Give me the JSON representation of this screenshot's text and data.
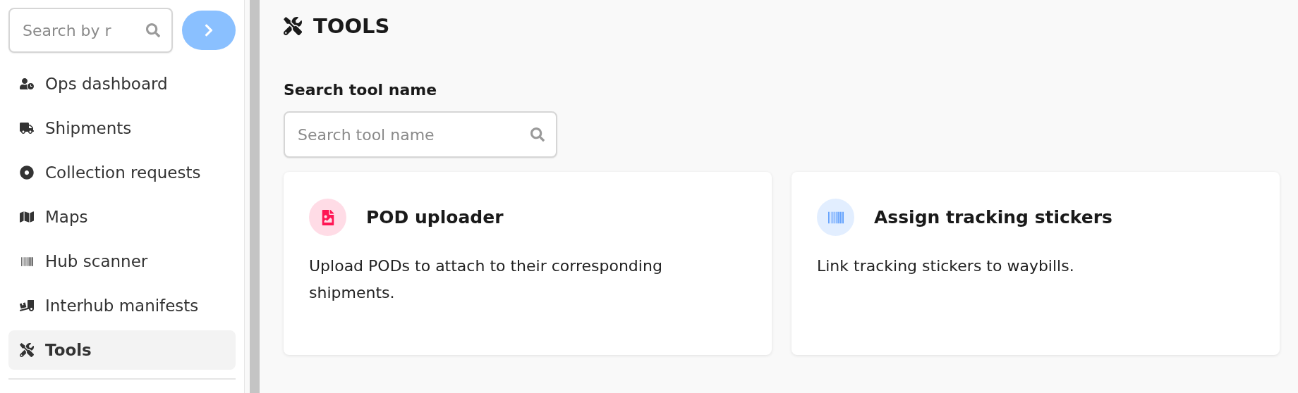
{
  "sidebar": {
    "search": {
      "placeholder": "Search by r"
    },
    "items": [
      {
        "label": "Ops dashboard",
        "selected": false
      },
      {
        "label": "Shipments",
        "selected": false
      },
      {
        "label": "Collection requests",
        "selected": false
      },
      {
        "label": "Maps",
        "selected": false
      },
      {
        "label": "Hub scanner",
        "selected": false
      },
      {
        "label": "Interhub manifests",
        "selected": false
      },
      {
        "label": "Tools",
        "selected": true
      }
    ]
  },
  "page": {
    "title": "TOOLS",
    "search_label": "Search tool name",
    "search": {
      "placeholder": "Search tool name"
    }
  },
  "cards": [
    {
      "title": "POD uploader",
      "description": "Upload PODs to attach to their corresponding shipments.",
      "color": "#ff1654"
    },
    {
      "title": "Assign tracking stickers",
      "description": "Link tracking stickers to waybills.",
      "color": "#3d8bfd"
    }
  ]
}
